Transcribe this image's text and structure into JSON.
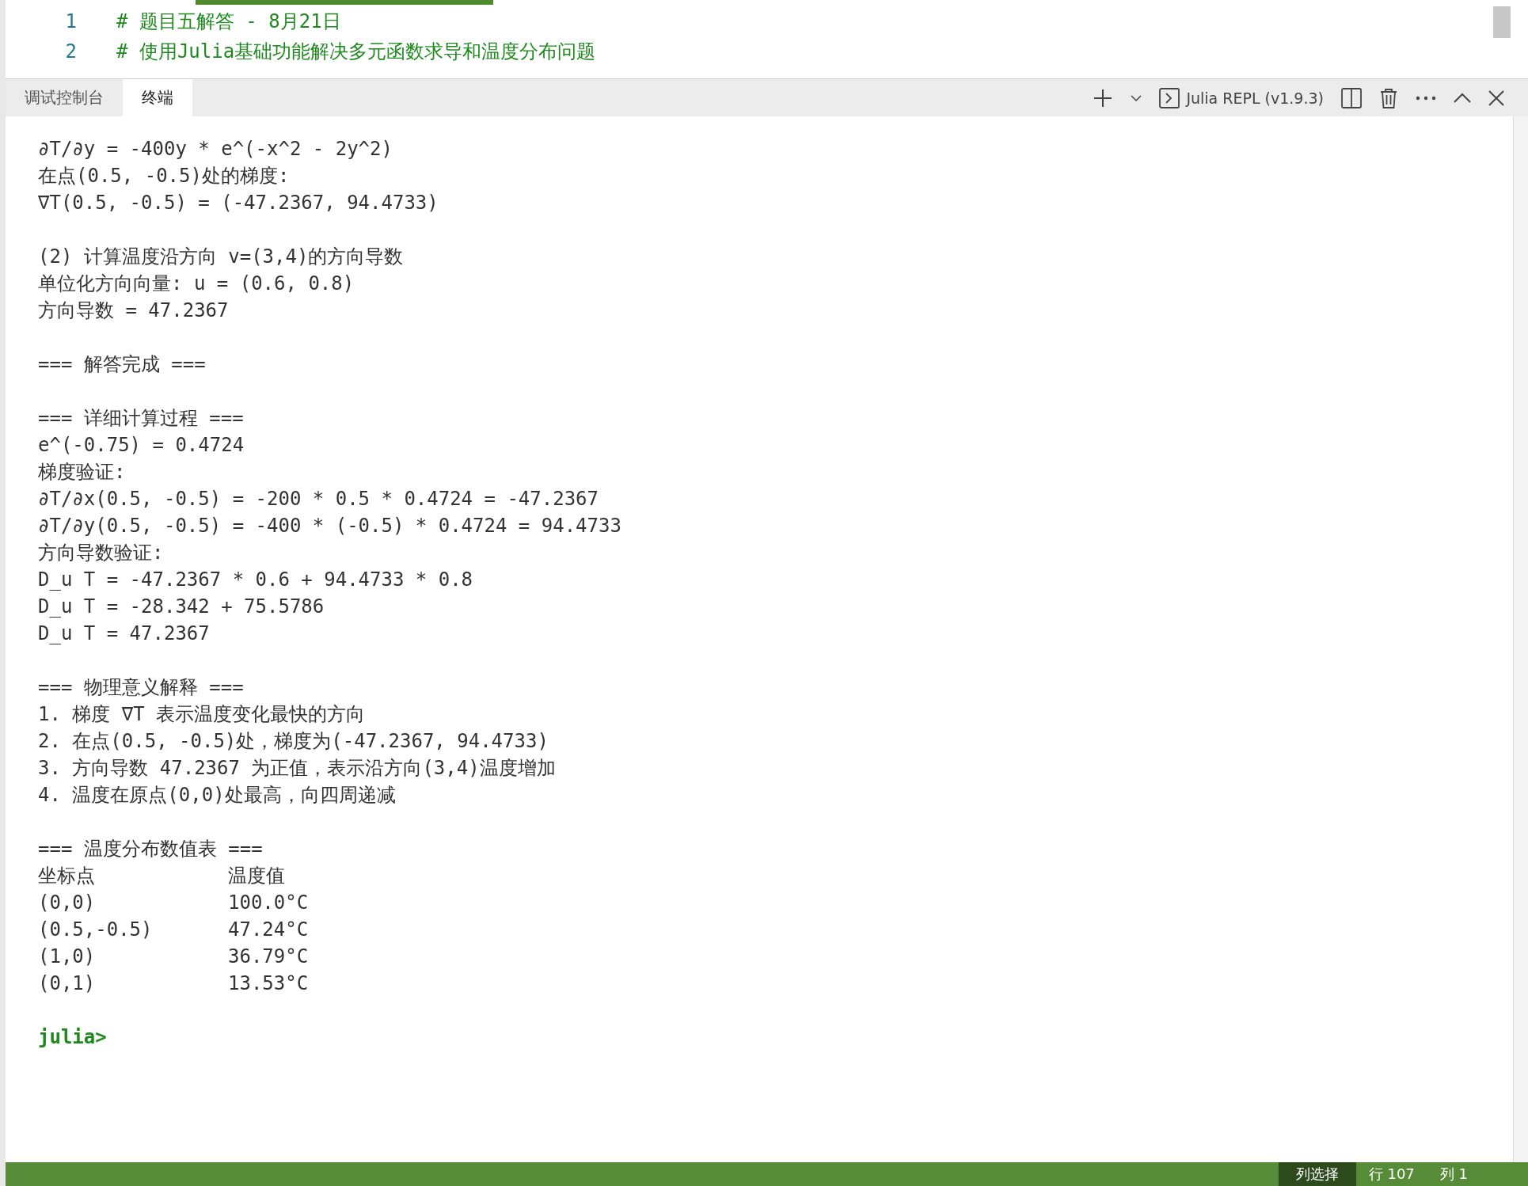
{
  "editor": {
    "lines": [
      {
        "number": "1",
        "text": "# 题目五解答 - 8月21日"
      },
      {
        "number": "2",
        "text": "# 使用Julia基础功能解决多元函数求导和温度分布问题"
      }
    ]
  },
  "panel": {
    "tabs": [
      {
        "label": "调试控制台",
        "selected": false
      },
      {
        "label": "终端",
        "selected": true
      }
    ],
    "terminal_name": "Julia REPL (v1.9.3)"
  },
  "terminal": {
    "blocks": [
      {
        "kind": "text",
        "lines": [
          "∂T/∂y = -400y * e^(-x^2 - 2y^2)",
          "在点(0.5, -0.5)处的梯度:",
          "∇T(0.5, -0.5) = (-47.2367, 94.4733)"
        ]
      },
      {
        "kind": "text",
        "lines": [
          "(2) 计算温度沿方向 v=(3,4)的方向导数",
          "单位化方向向量: u = (0.6, 0.8)",
          "方向导数 = 47.2367"
        ]
      },
      {
        "kind": "text",
        "lines": [
          "=== 解答完成 ==="
        ]
      },
      {
        "kind": "text",
        "lines": [
          "=== 详细计算过程 ===",
          "e^(-0.75) = 0.4724",
          "梯度验证:",
          "∂T/∂x(0.5, -0.5) = -200 * 0.5 * 0.4724 = -47.2367",
          "∂T/∂y(0.5, -0.5) = -400 * (-0.5) * 0.4724 = 94.4733",
          "方向导数验证:",
          "D_u T = -47.2367 * 0.6 + 94.4733 * 0.8",
          "D_u T = -28.342 + 75.5786",
          "D_u T = 47.2367"
        ]
      },
      {
        "kind": "text",
        "lines": [
          "=== 物理意义解释 ===",
          "1. 梯度 ∇T 表示温度变化最快的方向",
          "2. 在点(0.5, -0.5)处，梯度为(-47.2367, 94.4733)",
          "3. 方向导数 47.2367 为正值，表示沿方向(3,4)温度增加",
          "4. 温度在原点(0,0)处最高，向四周递减"
        ]
      },
      {
        "kind": "table",
        "title": "=== 温度分布数值表 ===",
        "columns": [
          "坐标点",
          "温度值"
        ],
        "rows": [
          [
            "(0,0)",
            "100.0°C"
          ],
          [
            "(0.5,-0.5)",
            "47.24°C"
          ],
          [
            "(1,0)",
            "36.79°C"
          ],
          [
            "(0,1)",
            "13.53°C"
          ]
        ]
      }
    ],
    "prompt": "julia>"
  },
  "status_bar": {
    "items": [
      {
        "label": "列选择",
        "selected": true
      },
      {
        "label": "行 107",
        "selected": false
      },
      {
        "label": "列 1",
        "selected": false
      }
    ]
  }
}
